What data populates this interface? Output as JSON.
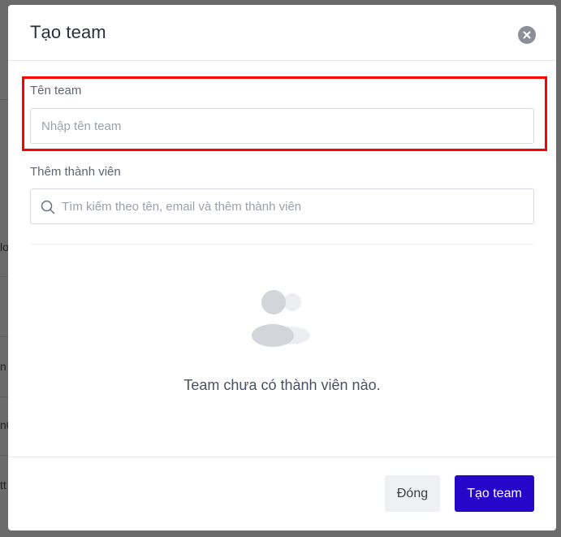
{
  "background": {
    "fragments": [
      "lo",
      "n",
      "n0",
      "tt"
    ]
  },
  "modal": {
    "title": "Tạo team",
    "close_icon": "close-icon",
    "team_name": {
      "label": "Tên team",
      "placeholder": "Nhập tên team",
      "value": ""
    },
    "members": {
      "label": "Thêm thành viên",
      "search_placeholder": "Tìm kiếm theo tên, email và thêm thành viên",
      "search_icon": "search-icon",
      "empty_icon": "users-icon",
      "empty_text": "Team chưa có thành viên nào."
    },
    "footer": {
      "close_label": "Đóng",
      "create_label": "Tạo team"
    }
  },
  "colors": {
    "primary": "#2606c8",
    "highlight": "#ff0000",
    "overlay": "#6b6b6b"
  }
}
